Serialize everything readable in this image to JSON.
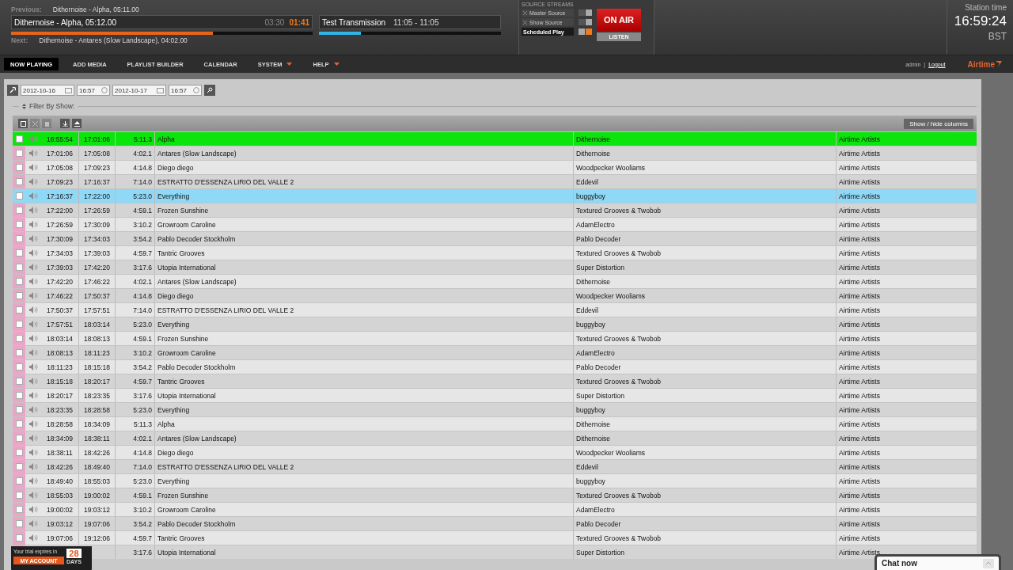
{
  "header": {
    "previous": {
      "label": "Previous:",
      "value": "Dithernoise - Alpha, 05:11.00"
    },
    "current": {
      "title": "Dithernoise - Alpha, 05:12.00",
      "elapsed": "03:30",
      "remaining": "01:41",
      "level": 0.67
    },
    "show": {
      "title": "Test Transmission",
      "time": "11:05 - 11:05",
      "level": 0.23
    },
    "next": {
      "label": "Next:",
      "value": "Dithernoise - Antares (Slow Landscape), 04:02.00"
    },
    "source_streams": {
      "title": "SOURCE STREAMS",
      "sources": [
        {
          "label": "Master Source",
          "on": false
        },
        {
          "label": "Show Source",
          "on": false
        },
        {
          "label": "Scheduled Play",
          "on": true
        }
      ]
    },
    "on_air": {
      "label": "ON AIR",
      "on": true
    },
    "listen": "LISTEN",
    "station_time": {
      "label": "Station time",
      "time": "16:59:24",
      "zone": "BST"
    }
  },
  "nav": {
    "items": [
      {
        "label": "NOW PLAYING",
        "selected": true,
        "dropdown": false
      },
      {
        "label": "ADD MEDIA",
        "selected": false,
        "dropdown": false
      },
      {
        "label": "PLAYLIST BUILDER",
        "selected": false,
        "dropdown": false
      },
      {
        "label": "CALENDAR",
        "selected": false,
        "dropdown": false
      },
      {
        "label": "SYSTEM",
        "selected": false,
        "dropdown": true
      },
      {
        "label": "HELP",
        "selected": false,
        "dropdown": true
      }
    ],
    "user": "admin",
    "separator": "|",
    "logout": "Logout",
    "logo": "Airtime"
  },
  "range": {
    "start_date": "2012-10-16",
    "start_time": "16:57",
    "end_date": "2012-10-17",
    "end_time": "16:57"
  },
  "filter": {
    "label": "Filter By Show:"
  },
  "table": {
    "tools": [
      {
        "kind": "select",
        "disabled": false
      },
      {
        "kind": "cut",
        "disabled": true
      },
      {
        "kind": "delete",
        "disabled": true
      },
      {
        "kind": "jump",
        "disabled": false
      },
      {
        "kind": "eject",
        "disabled": false
      }
    ],
    "columns_button": "Show / hide columns",
    "rows": [
      {
        "kind": "playing",
        "selected": false,
        "checked": false,
        "start": "16:55:54",
        "end": "17:01:06",
        "length": "5:11.3",
        "title": "Alpha",
        "creator": "Dithernoise",
        "album": "Airtime Artists"
      },
      {
        "kind": "scheduled",
        "selected": false,
        "checked": false,
        "start": "17:01:06",
        "end": "17:05:08",
        "length": "4:02.1",
        "title": "Antares (Slow Landscape)",
        "creator": "Dithernoise",
        "album": "Airtime Artists"
      },
      {
        "kind": "scheduled",
        "selected": false,
        "checked": false,
        "start": "17:05:08",
        "end": "17:09:23",
        "length": "4:14.8",
        "title": "Diego diego",
        "creator": "Woodpecker Wooliams",
        "album": "Airtime Artists"
      },
      {
        "kind": "scheduled",
        "selected": false,
        "checked": false,
        "start": "17:09:23",
        "end": "17:16:37",
        "length": "7:14.0",
        "title": "ESTRATTO D'ESSENZA LIRIO DEL VALLE 2",
        "creator": "Eddevil",
        "album": "Airtime Artists"
      },
      {
        "kind": "scheduled",
        "selected": true,
        "checked": false,
        "start": "17:16:37",
        "end": "17:22:00",
        "length": "5:23.0",
        "title": "Everything",
        "creator": "buggyboy",
        "album": "Airtime Artists"
      },
      {
        "kind": "scheduled",
        "selected": false,
        "checked": false,
        "start": "17:22:00",
        "end": "17:26:59",
        "length": "4:59.1",
        "title": "Frozen Sunshine",
        "creator": "Textured Grooves & Twobob",
        "album": "Airtime Artists"
      },
      {
        "kind": "scheduled",
        "selected": false,
        "checked": false,
        "start": "17:26:59",
        "end": "17:30:09",
        "length": "3:10.2",
        "title": "Growroom Caroline",
        "creator": "AdamElectro",
        "album": "Airtime Artists"
      },
      {
        "kind": "scheduled",
        "selected": false,
        "checked": false,
        "start": "17:30:09",
        "end": "17:34:03",
        "length": "3:54.2",
        "title": "Pablo Decoder Stockholm",
        "creator": "Pablo Decoder",
        "album": "Airtime Artists"
      },
      {
        "kind": "scheduled",
        "selected": false,
        "checked": false,
        "start": "17:34:03",
        "end": "17:39:03",
        "length": "4:59.7",
        "title": "Tantric Grooves",
        "creator": "Textured Grooves & Twobob",
        "album": "Airtime Artists"
      },
      {
        "kind": "scheduled",
        "selected": false,
        "checked": false,
        "start": "17:39:03",
        "end": "17:42:20",
        "length": "3:17.6",
        "title": "Utopia International",
        "creator": "Super Distortion",
        "album": "Airtime Artists"
      },
      {
        "kind": "scheduled",
        "selected": false,
        "checked": false,
        "start": "17:42:20",
        "end": "17:46:22",
        "length": "4:02.1",
        "title": "Antares (Slow Landscape)",
        "creator": "Dithernoise",
        "album": "Airtime Artists"
      },
      {
        "kind": "scheduled",
        "selected": false,
        "checked": false,
        "start": "17:46:22",
        "end": "17:50:37",
        "length": "4:14.8",
        "title": "Diego diego",
        "creator": "Woodpecker Wooliams",
        "album": "Airtime Artists"
      },
      {
        "kind": "scheduled",
        "selected": false,
        "checked": false,
        "start": "17:50:37",
        "end": "17:57:51",
        "length": "7:14.0",
        "title": "ESTRATTO D'ESSENZA LIRIO DEL VALLE 2",
        "creator": "Eddevil",
        "album": "Airtime Artists"
      },
      {
        "kind": "scheduled",
        "selected": false,
        "checked": false,
        "start": "17:57:51",
        "end": "18:03:14",
        "length": "5:23.0",
        "title": "Everything",
        "creator": "buggyboy",
        "album": "Airtime Artists"
      },
      {
        "kind": "scheduled",
        "selected": false,
        "checked": false,
        "start": "18:03:14",
        "end": "18:08:13",
        "length": "4:59.1",
        "title": "Frozen Sunshine",
        "creator": "Textured Grooves & Twobob",
        "album": "Airtime Artists"
      },
      {
        "kind": "scheduled",
        "selected": false,
        "checked": false,
        "start": "18:08:13",
        "end": "18:11:23",
        "length": "3:10.2",
        "title": "Growroom Caroline",
        "creator": "AdamElectro",
        "album": "Airtime Artists"
      },
      {
        "kind": "scheduled",
        "selected": false,
        "checked": false,
        "start": "18:11:23",
        "end": "18:15:18",
        "length": "3:54.2",
        "title": "Pablo Decoder Stockholm",
        "creator": "Pablo Decoder",
        "album": "Airtime Artists"
      },
      {
        "kind": "scheduled",
        "selected": false,
        "checked": false,
        "start": "18:15:18",
        "end": "18:20:17",
        "length": "4:59.7",
        "title": "Tantric Grooves",
        "creator": "Textured Grooves & Twobob",
        "album": "Airtime Artists"
      },
      {
        "kind": "scheduled",
        "selected": false,
        "checked": false,
        "start": "18:20:17",
        "end": "18:23:35",
        "length": "3:17.6",
        "title": "Utopia International",
        "creator": "Super Distortion",
        "album": "Airtime Artists"
      },
      {
        "kind": "scheduled",
        "selected": false,
        "checked": false,
        "start": "18:23:35",
        "end": "18:28:58",
        "length": "5:23.0",
        "title": "Everything",
        "creator": "buggyboy",
        "album": "Airtime Artists"
      },
      {
        "kind": "scheduled",
        "selected": false,
        "checked": false,
        "start": "18:28:58",
        "end": "18:34:09",
        "length": "5:11.3",
        "title": "Alpha",
        "creator": "Dithernoise",
        "album": "Airtime Artists"
      },
      {
        "kind": "scheduled",
        "selected": false,
        "checked": false,
        "start": "18:34:09",
        "end": "18:38:11",
        "length": "4:02.1",
        "title": "Antares (Slow Landscape)",
        "creator": "Dithernoise",
        "album": "Airtime Artists"
      },
      {
        "kind": "scheduled",
        "selected": false,
        "checked": false,
        "start": "18:38:11",
        "end": "18:42:26",
        "length": "4:14.8",
        "title": "Diego diego",
        "creator": "Woodpecker Wooliams",
        "album": "Airtime Artists"
      },
      {
        "kind": "scheduled",
        "selected": false,
        "checked": false,
        "start": "18:42:26",
        "end": "18:49:40",
        "length": "7:14.0",
        "title": "ESTRATTO D'ESSENZA LIRIO DEL VALLE 2",
        "creator": "Eddevil",
        "album": "Airtime Artists"
      },
      {
        "kind": "scheduled",
        "selected": false,
        "checked": false,
        "start": "18:49:40",
        "end": "18:55:03",
        "length": "5:23.0",
        "title": "Everything",
        "creator": "buggyboy",
        "album": "Airtime Artists"
      },
      {
        "kind": "scheduled",
        "selected": false,
        "checked": false,
        "start": "18:55:03",
        "end": "19:00:02",
        "length": "4:59.1",
        "title": "Frozen Sunshine",
        "creator": "Textured Grooves & Twobob",
        "album": "Airtime Artists"
      },
      {
        "kind": "scheduled",
        "selected": false,
        "checked": false,
        "start": "19:00:02",
        "end": "19:03:12",
        "length": "3:10.2",
        "title": "Growroom Caroline",
        "creator": "AdamElectro",
        "album": "Airtime Artists"
      },
      {
        "kind": "scheduled",
        "selected": false,
        "checked": false,
        "start": "19:03:12",
        "end": "19:07:06",
        "length": "3:54.2",
        "title": "Pablo Decoder Stockholm",
        "creator": "Pablo Decoder",
        "album": "Airtime Artists"
      },
      {
        "kind": "scheduled",
        "selected": false,
        "checked": false,
        "start": "19:07:06",
        "end": "19:12:06",
        "length": "4:59.7",
        "title": "Tantric Grooves",
        "creator": "Textured Grooves & Twobob",
        "album": "Airtime Artists"
      },
      {
        "kind": "scheduled",
        "selected": false,
        "length": "3:17.6",
        "title": "Utopia International",
        "creator": "Super Distortion",
        "album": "Airtime Artists"
      }
    ]
  },
  "trial": {
    "text": "Your trial expires in",
    "days": "28",
    "days_label": "DAYS",
    "account_button": "MY ACCOUNT"
  },
  "chat": {
    "label": "Chat now"
  }
}
